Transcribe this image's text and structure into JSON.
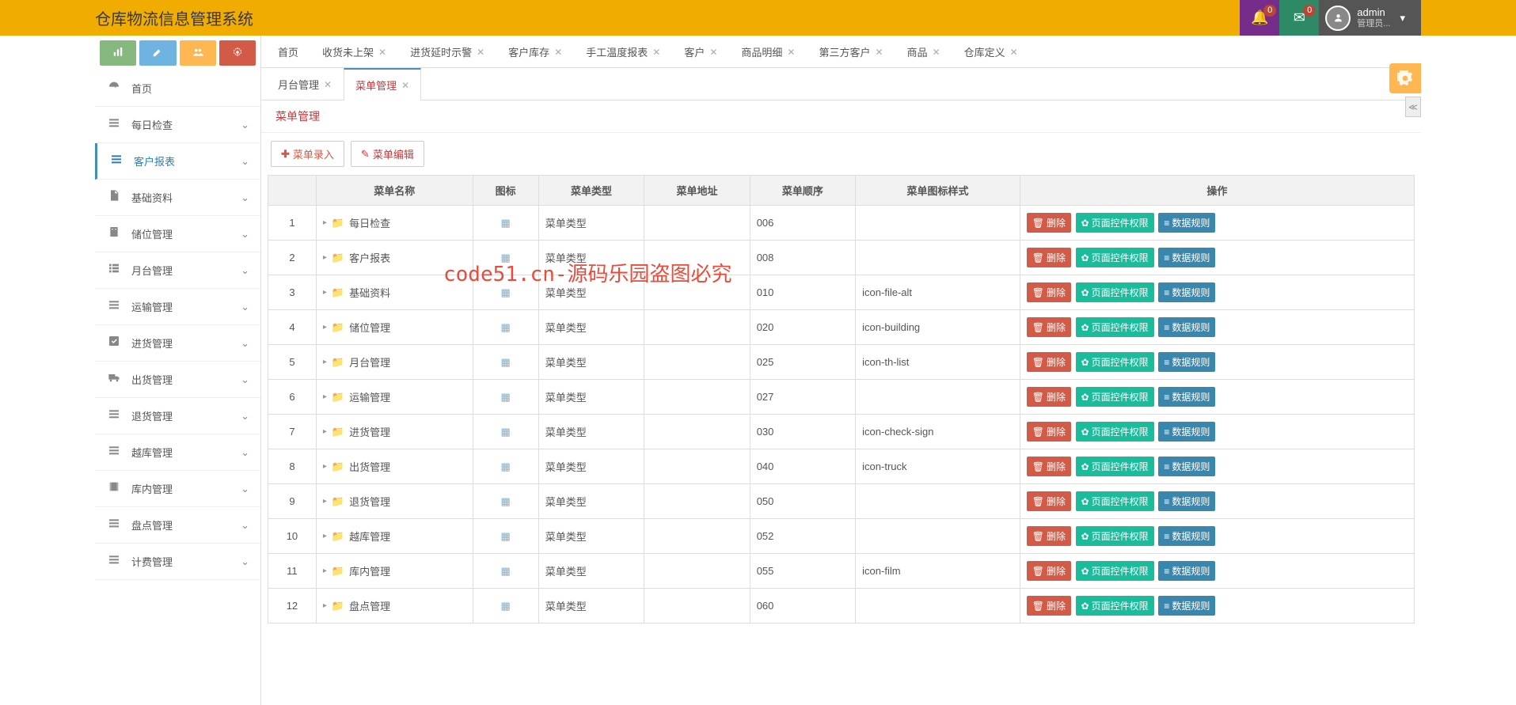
{
  "app_title": "仓库物流信息管理系统",
  "notifications": {
    "bell_count": "0",
    "mail_count": "0"
  },
  "user": {
    "name": "admin",
    "role": "管理员..."
  },
  "sidebar": {
    "items": [
      {
        "label": "首页",
        "icon": "dashboard",
        "expandable": false
      },
      {
        "label": "每日检查",
        "icon": "list",
        "expandable": true
      },
      {
        "label": "客户报表",
        "icon": "list",
        "expandable": true,
        "active": true
      },
      {
        "label": "基础资料",
        "icon": "file",
        "expandable": true
      },
      {
        "label": "储位管理",
        "icon": "building",
        "expandable": true
      },
      {
        "label": "月台管理",
        "icon": "th-list",
        "expandable": true
      },
      {
        "label": "运输管理",
        "icon": "list",
        "expandable": true
      },
      {
        "label": "进货管理",
        "icon": "check",
        "expandable": true
      },
      {
        "label": "出货管理",
        "icon": "truck",
        "expandable": true
      },
      {
        "label": "退货管理",
        "icon": "list",
        "expandable": true
      },
      {
        "label": "越库管理",
        "icon": "list",
        "expandable": true
      },
      {
        "label": "库内管理",
        "icon": "film",
        "expandable": true
      },
      {
        "label": "盘点管理",
        "icon": "list",
        "expandable": true
      },
      {
        "label": "计费管理",
        "icon": "list",
        "expandable": true
      }
    ]
  },
  "tabs_row1": [
    {
      "label": "首页",
      "closable": false
    },
    {
      "label": "收货未上架",
      "closable": true
    },
    {
      "label": "进货延时示警",
      "closable": true
    },
    {
      "label": "客户库存",
      "closable": true
    },
    {
      "label": "手工温度报表",
      "closable": true
    },
    {
      "label": "客户",
      "closable": true
    },
    {
      "label": "商品明细",
      "closable": true
    },
    {
      "label": "第三方客户",
      "closable": true
    },
    {
      "label": "商品",
      "closable": true
    },
    {
      "label": "仓库定义",
      "closable": true
    }
  ],
  "tabs_row2": [
    {
      "label": "月台管理",
      "closable": true
    },
    {
      "label": "菜单管理",
      "closable": true,
      "active": true
    }
  ],
  "panel": {
    "title": "菜单管理",
    "add_btn": "菜单录入",
    "edit_btn": "菜单编辑"
  },
  "table": {
    "headers": [
      "",
      "菜单名称",
      "图标",
      "菜单类型",
      "菜单地址",
      "菜单顺序",
      "菜单图标样式",
      "操作"
    ],
    "ops": {
      "delete": "删除",
      "perm": "页面控件权限",
      "data": "数据规则"
    },
    "rows": [
      {
        "num": "1",
        "name": "每日检查",
        "type": "菜单类型",
        "addr": "",
        "order": "006",
        "style": ""
      },
      {
        "num": "2",
        "name": "客户报表",
        "type": "菜单类型",
        "addr": "",
        "order": "008",
        "style": ""
      },
      {
        "num": "3",
        "name": "基础资料",
        "type": "菜单类型",
        "addr": "",
        "order": "010",
        "style": "icon-file-alt"
      },
      {
        "num": "4",
        "name": "储位管理",
        "type": "菜单类型",
        "addr": "",
        "order": "020",
        "style": "icon-building"
      },
      {
        "num": "5",
        "name": "月台管理",
        "type": "菜单类型",
        "addr": "",
        "order": "025",
        "style": "icon-th-list"
      },
      {
        "num": "6",
        "name": "运输管理",
        "type": "菜单类型",
        "addr": "",
        "order": "027",
        "style": ""
      },
      {
        "num": "7",
        "name": "进货管理",
        "type": "菜单类型",
        "addr": "",
        "order": "030",
        "style": "icon-check-sign"
      },
      {
        "num": "8",
        "name": "出货管理",
        "type": "菜单类型",
        "addr": "",
        "order": "040",
        "style": "icon-truck"
      },
      {
        "num": "9",
        "name": "退货管理",
        "type": "菜单类型",
        "addr": "",
        "order": "050",
        "style": ""
      },
      {
        "num": "10",
        "name": "越库管理",
        "type": "菜单类型",
        "addr": "",
        "order": "052",
        "style": ""
      },
      {
        "num": "11",
        "name": "库内管理",
        "type": "菜单类型",
        "addr": "",
        "order": "055",
        "style": "icon-film"
      },
      {
        "num": "12",
        "name": "盘点管理",
        "type": "菜单类型",
        "addr": "",
        "order": "060",
        "style": ""
      }
    ]
  },
  "watermark": "code51.cn-源码乐园盗图必究"
}
